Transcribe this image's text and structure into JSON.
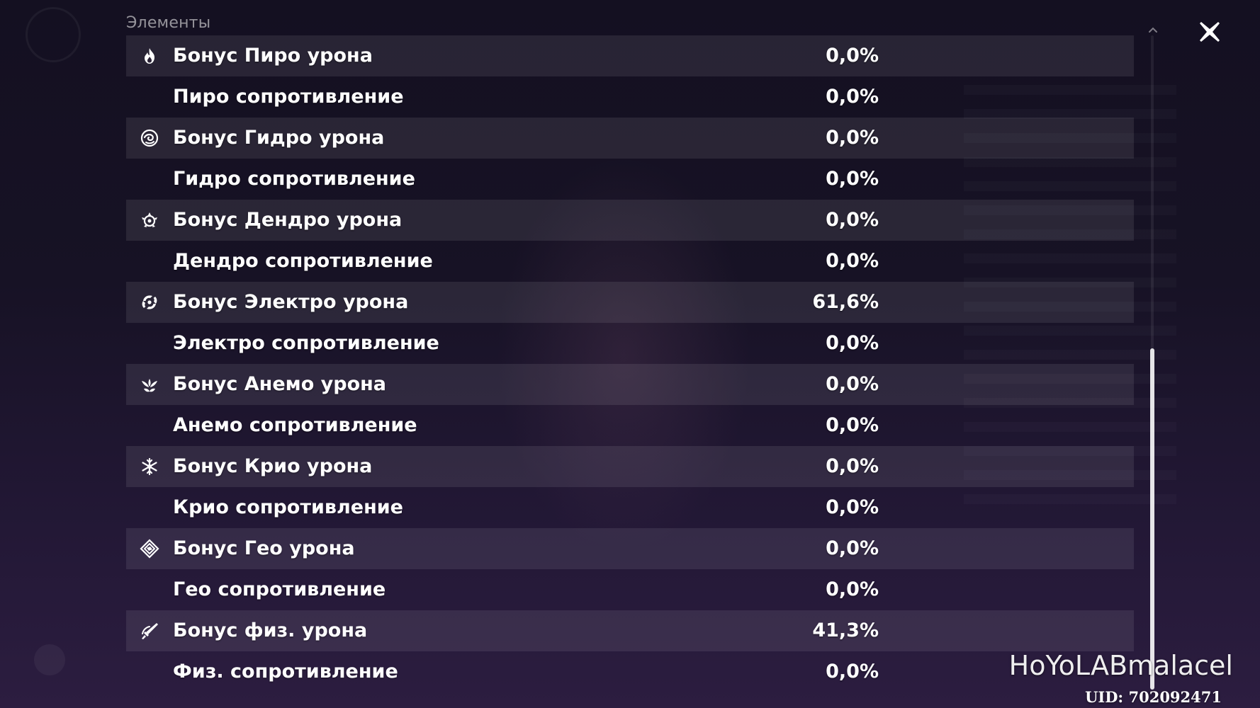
{
  "section_title": "Элементы",
  "rows": [
    {
      "icon": "pyro-icon",
      "label": "Бонус Пиро урона",
      "value": "0,0%"
    },
    {
      "icon": "",
      "label": "Пиро сопротивление",
      "value": "0,0%"
    },
    {
      "icon": "hydro-icon",
      "label": "Бонус Гидро урона",
      "value": "0,0%"
    },
    {
      "icon": "",
      "label": "Гидро сопротивление",
      "value": "0,0%"
    },
    {
      "icon": "dendro-icon",
      "label": "Бонус Дендро урона",
      "value": "0,0%"
    },
    {
      "icon": "",
      "label": "Дендро сопротивление",
      "value": "0,0%"
    },
    {
      "icon": "electro-icon",
      "label": "Бонус Электро урона",
      "value": "61,6%"
    },
    {
      "icon": "",
      "label": "Электро сопротивление",
      "value": "0,0%"
    },
    {
      "icon": "anemo-icon",
      "label": "Бонус Анемо урона",
      "value": "0,0%"
    },
    {
      "icon": "",
      "label": "Анемо сопротивление",
      "value": "0,0%"
    },
    {
      "icon": "cryo-icon",
      "label": "Бонус Крио урона",
      "value": "0,0%"
    },
    {
      "icon": "",
      "label": "Крио сопротивление",
      "value": "0,0%"
    },
    {
      "icon": "geo-icon",
      "label": "Бонус Гео урона",
      "value": "0,0%"
    },
    {
      "icon": "",
      "label": "Гео сопротивление",
      "value": "0,0%"
    },
    {
      "icon": "physical-icon",
      "label": "Бонус физ. урона",
      "value": "41,3%"
    },
    {
      "icon": "",
      "label": "Физ. сопротивление",
      "value": "0,0%"
    }
  ],
  "close_icon": "close-icon",
  "watermark": "HoYoLABmalacel",
  "uid": "UID: 702092471"
}
